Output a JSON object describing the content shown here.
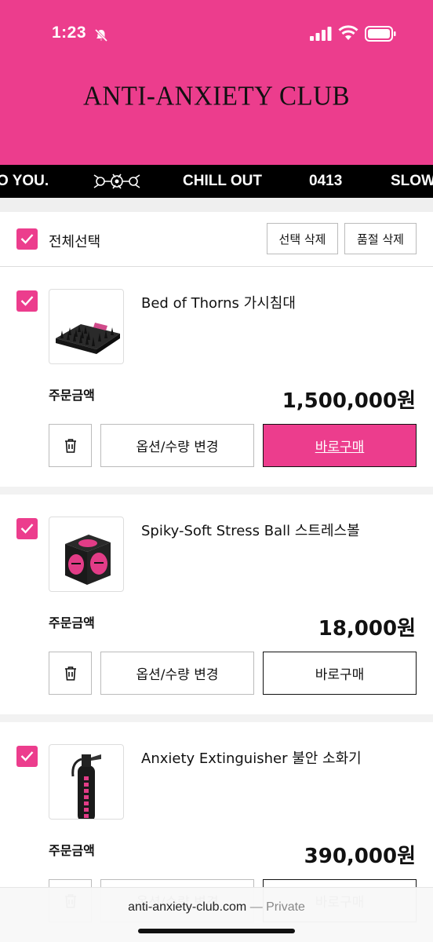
{
  "status": {
    "time": "1:23"
  },
  "header": {
    "brand": "ANTI-ANXIETY CLUB"
  },
  "marquee": {
    "items": [
      "O YOU.",
      "CHILL OUT",
      "0413",
      "SLOW"
    ]
  },
  "select_all": {
    "label": "전체선택",
    "delete_selected": "선택 삭제",
    "delete_soldout": "품절 삭제",
    "checked": true
  },
  "cart": {
    "amount_label": "주문금액",
    "option_button": "옵션/수량 변경",
    "buy_button": "바로구매",
    "items": [
      {
        "title": "Bed of Thorns 가시침대",
        "price": "1,500,000원",
        "checked": true
      },
      {
        "title": "Spiky-Soft Stress Ball 스트레스볼",
        "price": "18,000원",
        "checked": true
      },
      {
        "title": "Anxiety Extinguisher 불안 소화기",
        "price": "390,000원",
        "checked": true
      }
    ]
  },
  "browser": {
    "url": "anti-anxiety-club.com",
    "private": "— Private"
  },
  "colors": {
    "accent": "#ec3d8d",
    "marquee_bg": "#000000"
  }
}
